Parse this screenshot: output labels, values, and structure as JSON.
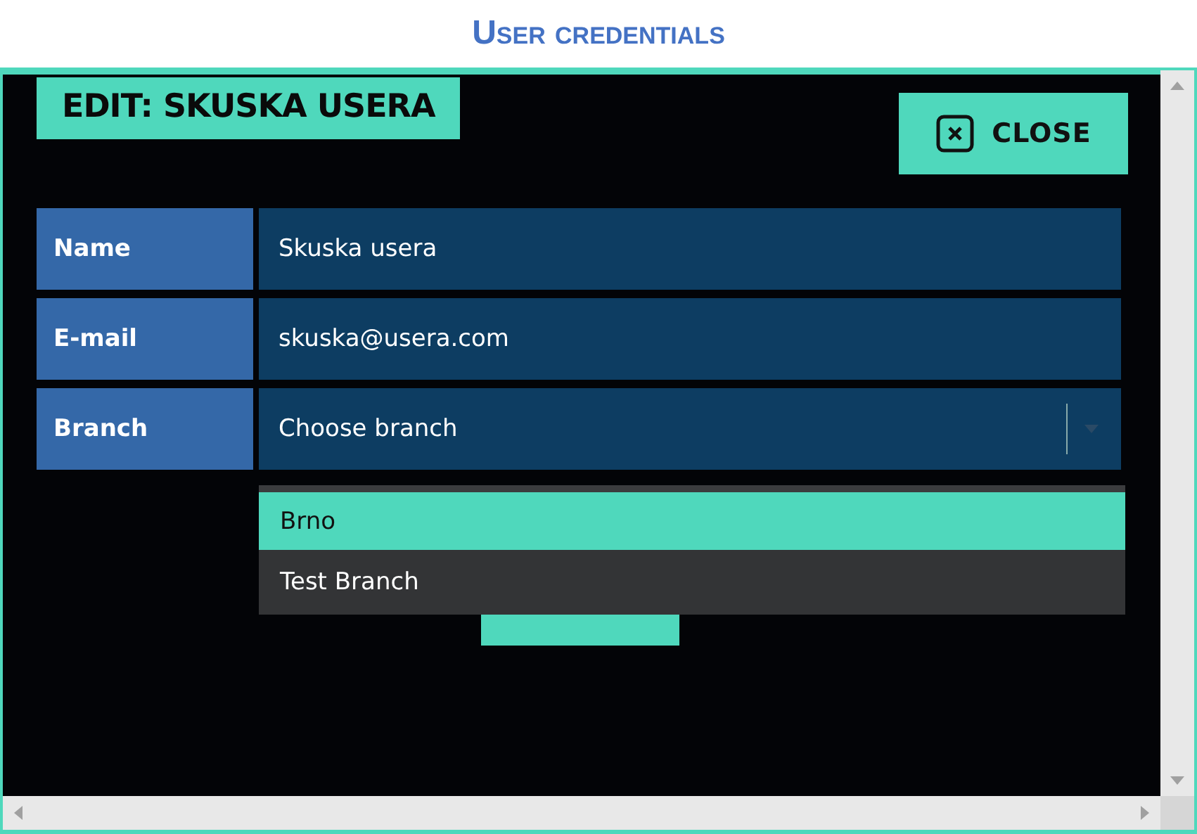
{
  "title": "User credentials",
  "dialog": {
    "heading": "EDIT: SKUSKA USERA",
    "close_button": "CLOSE",
    "fields": [
      {
        "label": "Name",
        "value": "Skuska usera",
        "kind": "text"
      },
      {
        "label": "E-mail",
        "value": "skuska@usera.com",
        "kind": "text"
      },
      {
        "label": "Branch",
        "placeholder": "Choose branch",
        "kind": "select"
      }
    ],
    "dropdown": [
      {
        "label": "Brno",
        "selected": true
      },
      {
        "label": "Test Branch",
        "selected": false
      }
    ]
  }
}
